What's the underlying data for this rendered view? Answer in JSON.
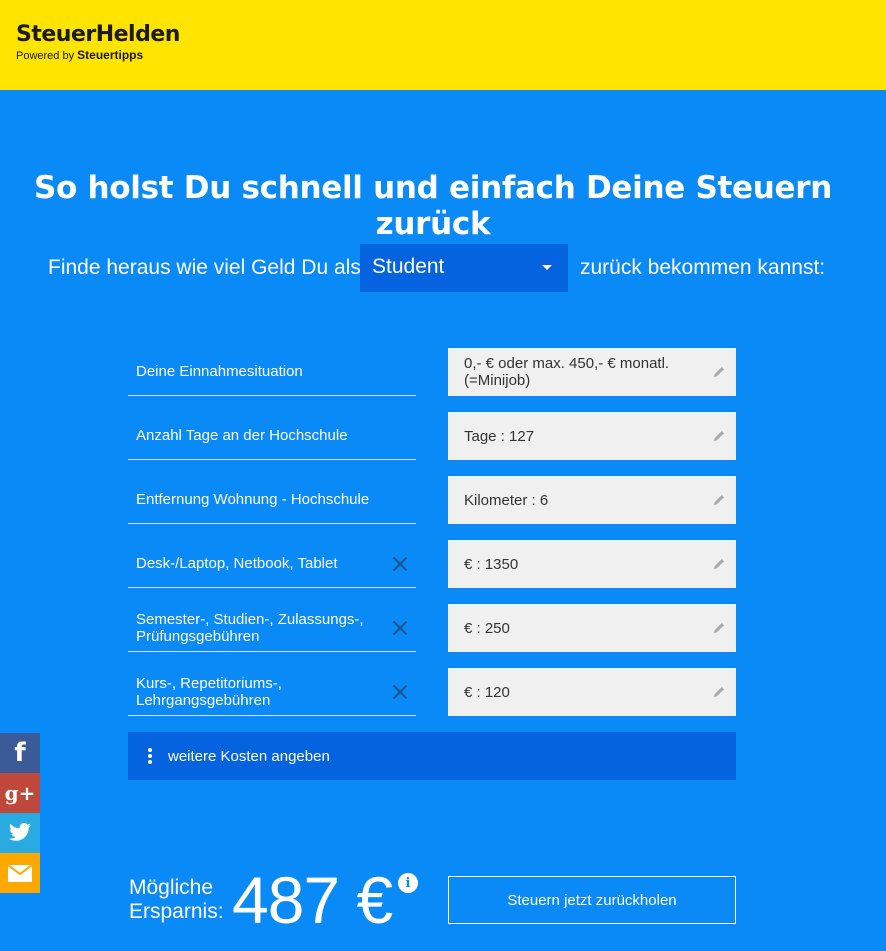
{
  "header": {
    "logo_main": "SteuerHelden",
    "logo_powered": "Powered by",
    "logo_brand": "Steuertipps"
  },
  "headline": "So holst Du schnell und einfach Deine Steuern zurück",
  "intro": {
    "pre": "Finde heraus wie viel Geld Du als",
    "selected_role": "Student",
    "post": "zurück bekommen kannst:"
  },
  "rows": [
    {
      "label": "Deine Einnahmesituation",
      "value": "0,- € oder max. 450,- € monatl. (=Minijob)",
      "removable": false
    },
    {
      "label": "Anzahl Tage an der Hochschule",
      "value": "Tage : 127",
      "removable": false
    },
    {
      "label": "Entfernung Wohnung - Hochschule",
      "value": "Kilometer : 6",
      "removable": false
    },
    {
      "label": "Desk-/Laptop, Netbook, Tablet",
      "value": "€ : 1350",
      "removable": true
    },
    {
      "label": "Semester-, Studien-, Zulassungs-, Prüfungsgebühren",
      "value": "€ : 250",
      "removable": true
    },
    {
      "label": "Kurs-, Repetitoriums-, Lehrgangsgebühren",
      "value": "€ : 120",
      "removable": true
    }
  ],
  "more_costs_label": "weitere Kosten angeben",
  "social": [
    {
      "name": "facebook",
      "glyph": "f"
    },
    {
      "name": "google-plus",
      "glyph": "g+"
    },
    {
      "name": "twitter",
      "glyph": ""
    },
    {
      "name": "email",
      "glyph": ""
    }
  ],
  "saving": {
    "label_line1": "Mögliche",
    "label_line2": "Ersparnis:",
    "value": "487 €",
    "info_glyph": "i"
  },
  "cta_label": "Steuern jetzt zurückholen",
  "colors": {
    "header_bg": "#ffe400",
    "page_bg": "#0a8af7",
    "accent_dark": "#0563e0"
  }
}
